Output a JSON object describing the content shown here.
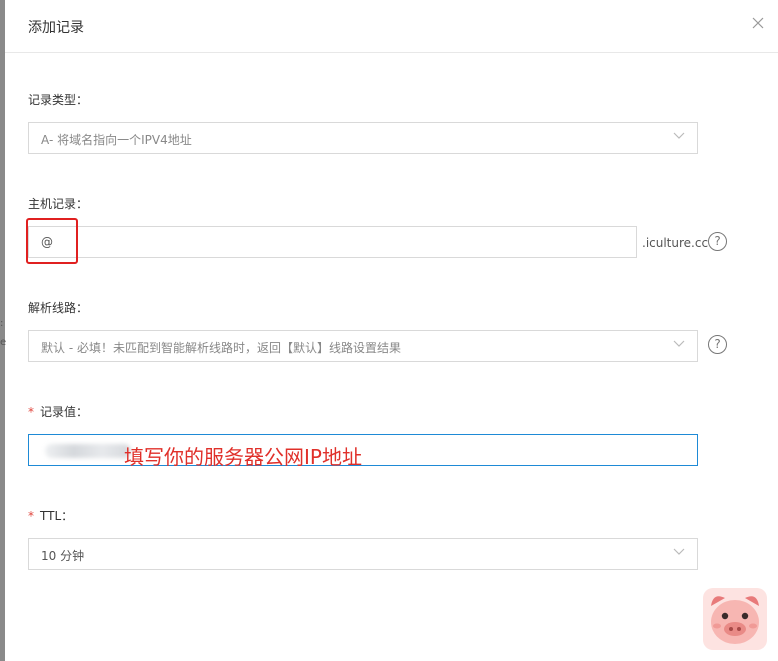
{
  "dialog": {
    "title": "添加记录",
    "close_label": "X"
  },
  "form": {
    "record_type": {
      "label": "记录类型：",
      "value": "A- 将域名指向一个IPV4地址"
    },
    "host_record": {
      "label": "主机记录：",
      "value": "@",
      "domain_suffix": ".iculture.cc",
      "help": "?"
    },
    "resolution_line": {
      "label": "解析线路：",
      "value": "默认 - 必填！未匹配到智能解析线路时，返回【默认】线路设置结果",
      "help": "?"
    },
    "record_value": {
      "required_mark": "*",
      "label": "记录值：",
      "annotation": "填写你的服务器公网IP地址"
    },
    "ttl": {
      "required_mark": "*",
      "label": "TTL：",
      "value": "10 分钟"
    }
  },
  "icons": {
    "dropdown": "chevron-down-icon",
    "help": "question-circle-icon",
    "close": "close-icon",
    "mascot": "pig-mascot-icon"
  },
  "colors": {
    "required": "#e0463e",
    "annotation": "#e0302a",
    "highlight": "#e02020",
    "focus_border": "#1e8ad6",
    "mascot_bg": "#fde3e1",
    "mascot_ear": "#e87a7a"
  }
}
